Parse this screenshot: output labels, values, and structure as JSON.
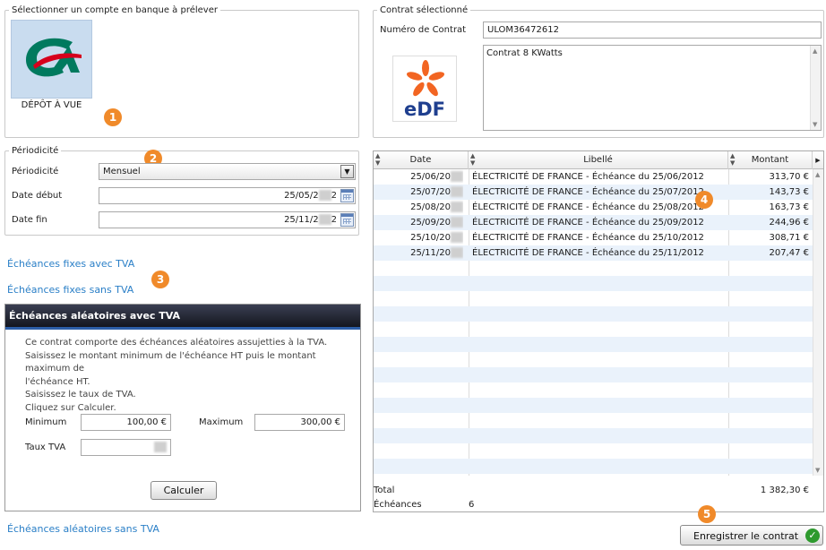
{
  "bank_section": {
    "legend": "Sélectionner un compte en banque à prélever",
    "account_label": "DÉPÔT À VUE",
    "bank_logo_color": "#007a5e",
    "bank_logo_accent": "#d6001c"
  },
  "contract_section": {
    "legend": "Contrat sélectionné",
    "number_label": "Numéro de Contrat",
    "number_value": "ULOM36472612",
    "description_value": "Contrat 8 KWatts",
    "logo_text": "eDF",
    "logo_color": "#1f3f8f",
    "logo_accent": "#f26522"
  },
  "periodicity_section": {
    "legend": "Périodicité",
    "periodicity_label": "Périodicité",
    "periodicity_value": "Mensuel",
    "start_label": "Date début",
    "start_value": "25/05/2",
    "start_suffix": "2",
    "end_label": "Date fin",
    "end_value": "25/11/2",
    "end_suffix": "2"
  },
  "links": {
    "fixed_vat": "Échéances fixes avec TVA",
    "fixed_novat": "Échéances fixes sans TVA",
    "random_novat": "Échéances aléatoires sans TVA"
  },
  "random_vat_panel": {
    "title": "Échéances aléatoires avec TVA",
    "instructions": [
      "Ce contrat comporte des échéances aléatoires assujetties à la TVA.",
      "Saisissez le montant minimum de l'échéance HT puis le montant maximum de",
      "l'échéance HT.",
      "Saisissez le taux de TVA.",
      "Cliquez sur Calculer."
    ],
    "min_label": "Minimum",
    "min_value": "100,00 €",
    "max_label": "Maximum",
    "max_value": "300,00 €",
    "vat_label": "Taux TVA",
    "calc_button": "Calculer"
  },
  "schedule_table": {
    "columns": [
      "Date",
      "Libellé",
      "Montant"
    ],
    "rows": [
      {
        "date": "25/06/20",
        "label": "ÉLECTRICITÉ DE FRANCE - Échéance du 25/06/2012",
        "amount": "313,70 €"
      },
      {
        "date": "25/07/20",
        "label": "ÉLECTRICITÉ DE FRANCE - Échéance du 25/07/2012",
        "amount": "143,73 €"
      },
      {
        "date": "25/08/20",
        "label": "ÉLECTRICITÉ DE FRANCE - Échéance du 25/08/2012",
        "amount": "163,73 €"
      },
      {
        "date": "25/09/20",
        "label": "ÉLECTRICITÉ DE FRANCE - Échéance du 25/09/2012",
        "amount": "244,96 €"
      },
      {
        "date": "25/10/20",
        "label": "ÉLECTRICITÉ DE FRANCE - Échéance du 25/10/2012",
        "amount": "308,71 €"
      },
      {
        "date": "25/11/20",
        "label": "ÉLECTRICITÉ DE FRANCE - Échéance du 25/11/2012",
        "amount": "207,47 €"
      }
    ],
    "total_label": "Total",
    "total_value": "1 382,30 €",
    "count_label": "Échéances",
    "count_value": "6"
  },
  "save_button": "Enregistrer le contrat",
  "callouts": [
    "1",
    "2",
    "3",
    "4",
    "5"
  ],
  "accent_color": "#f08a2a",
  "link_color": "#2a7fc7"
}
